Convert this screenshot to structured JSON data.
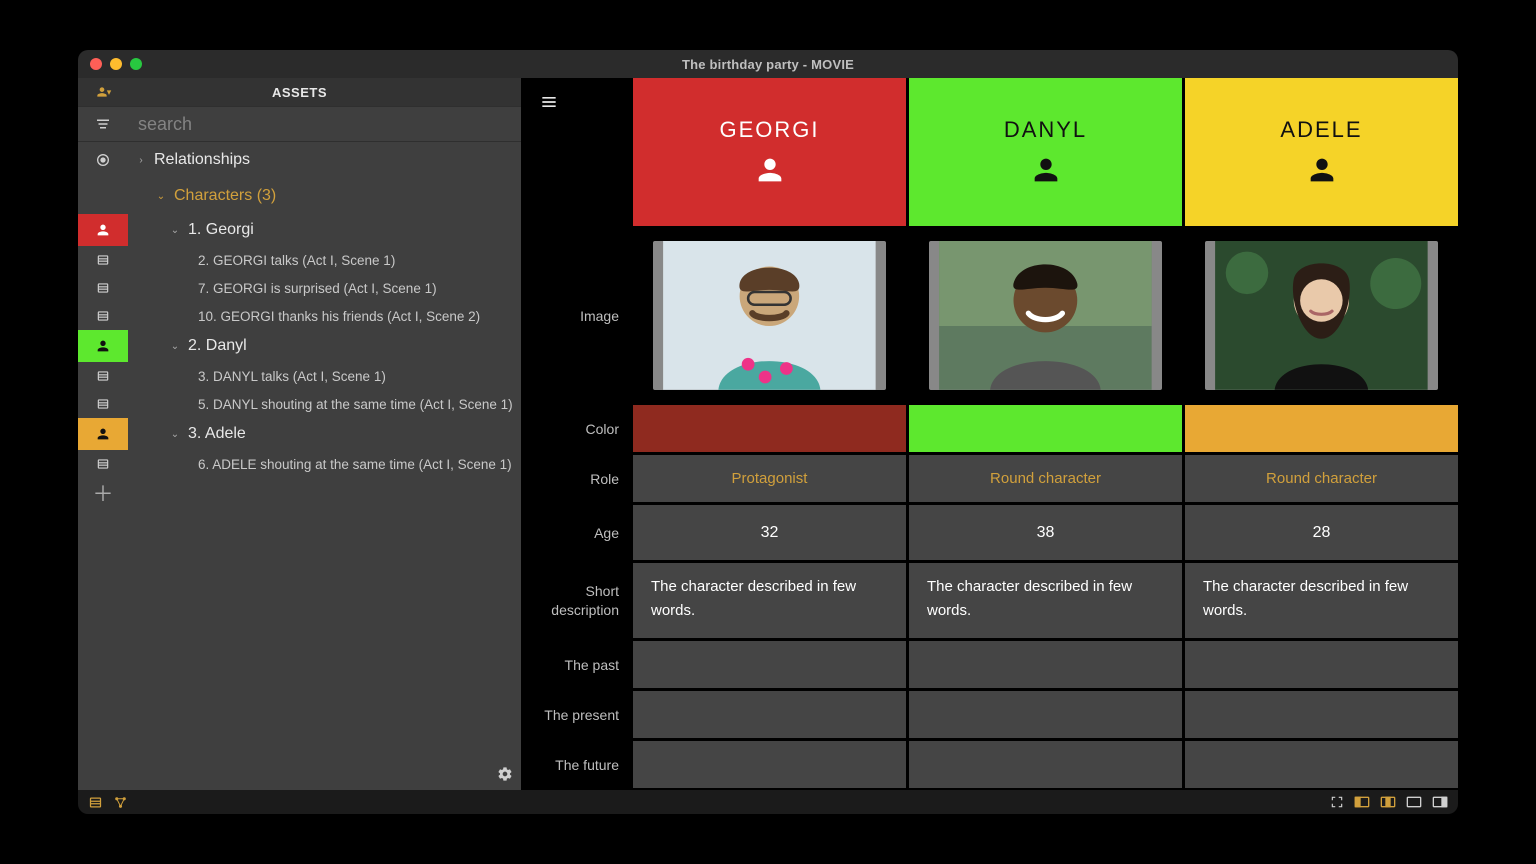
{
  "window": {
    "title": "The birthday party - MOVIE"
  },
  "assets": {
    "header": "ASSETS",
    "search_placeholder": "search"
  },
  "tree": {
    "relationships": "Relationships",
    "characters_label": "Characters (3)",
    "georgi": {
      "label": "1. Georgi",
      "beats": [
        "2. GEORGI talks (Act I, Scene 1)",
        "7. GEORGI is surprised (Act I, Scene 1)",
        "10. GEORGI thanks his friends (Act I, Scene 2)"
      ]
    },
    "danyl": {
      "label": "2. Danyl",
      "beats": [
        "3. DANYL talks (Act I, Scene 1)",
        "5. DANYL shouting at the same time (Act I, Scene 1)"
      ]
    },
    "adele": {
      "label": "3. Adele",
      "beats": [
        "6. ADELE shouting at the same time (Act I, Scene 1)"
      ]
    }
  },
  "grid": {
    "row_labels": {
      "image": "Image",
      "color": "Color",
      "role": "Role",
      "age": "Age",
      "short_desc": "Short\ndescription",
      "past": "The past",
      "present": "The present",
      "future": "The future"
    },
    "characters": [
      {
        "name": "GEORGI",
        "header_color": "red",
        "swatch": "red",
        "role": "Protagonist",
        "age": "32",
        "short_desc": "The character described in few words."
      },
      {
        "name": "DANYL",
        "header_color": "green",
        "swatch": "green",
        "role": "Round character",
        "age": "38",
        "short_desc": "The character described in few words."
      },
      {
        "name": "ADELE",
        "header_color": "yellow",
        "swatch": "orange",
        "role": "Round character",
        "age": "28",
        "short_desc": "The character described in few words."
      }
    ]
  }
}
